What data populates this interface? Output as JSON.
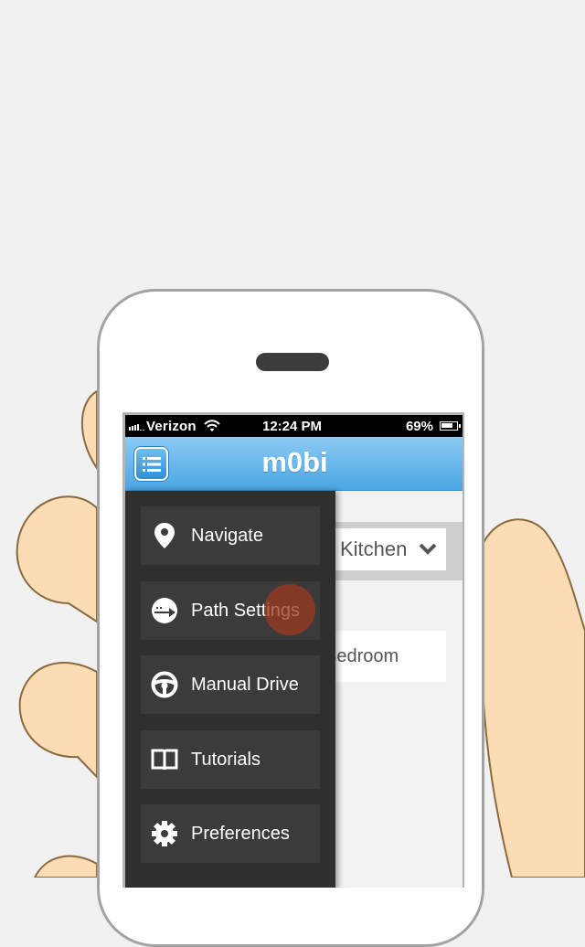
{
  "status_bar": {
    "carrier": "Verizon",
    "time": "12:24 PM",
    "battery": "69%"
  },
  "nav": {
    "title": "m0bi",
    "menu_icon": "list-icon"
  },
  "content": {
    "select_value": "Kitchen",
    "select_icon": "chevron-down-icon",
    "destination_text": "Bedroom"
  },
  "menu": {
    "items": [
      {
        "label": "Navigate",
        "icon": "map-pin-icon"
      },
      {
        "label": "Path Settings",
        "icon": "path-icon"
      },
      {
        "label": "Manual Drive",
        "icon": "steering-wheel-icon"
      },
      {
        "label": "Tutorials",
        "icon": "book-icon"
      },
      {
        "label": "Preferences",
        "icon": "gear-icon"
      }
    ]
  },
  "colors": {
    "nav_blue_top": "#8ccaf4",
    "nav_blue_bottom": "#4aa6e3",
    "drawer_bg": "#2f2f2f",
    "menu_item_bg": "#3b3b3b",
    "tap_indicator": "#9e3a22",
    "skin": "#fcdcb4",
    "skin_outline": "#8c6a3f"
  }
}
